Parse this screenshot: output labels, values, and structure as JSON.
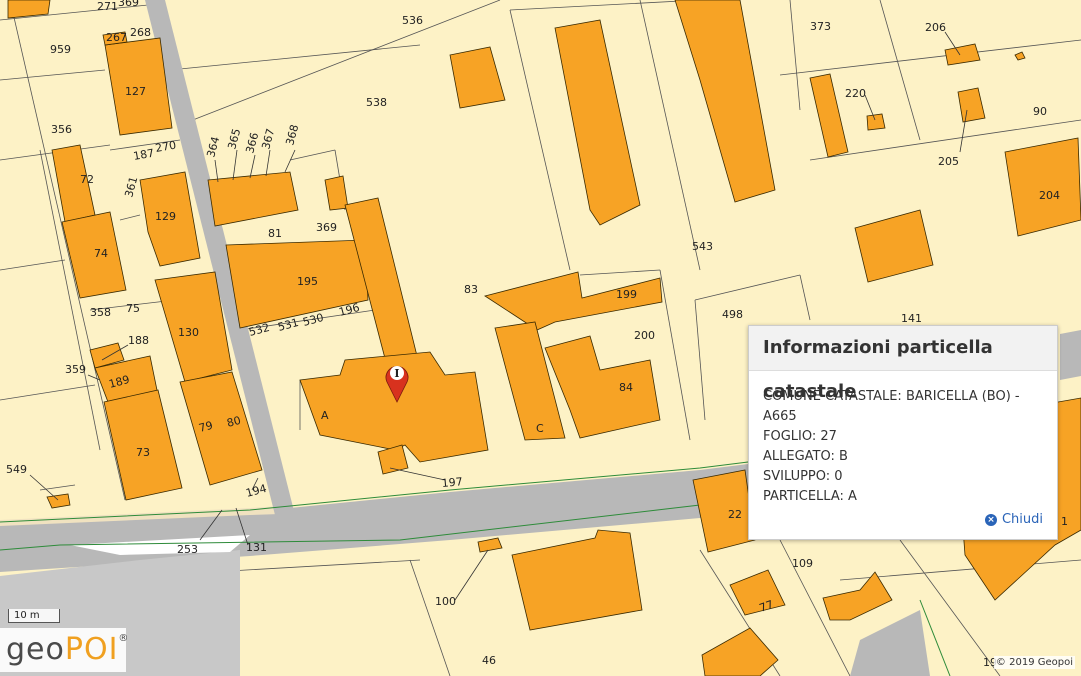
{
  "map": {
    "parcel_labels": [
      {
        "id": "p271",
        "t": "271"
      },
      {
        "id": "p369t",
        "t": "369"
      },
      {
        "id": "p536",
        "t": "536"
      },
      {
        "id": "p373",
        "t": "373"
      },
      {
        "id": "p206",
        "t": "206"
      },
      {
        "id": "p959",
        "t": "959"
      },
      {
        "id": "p267",
        "t": "267"
      },
      {
        "id": "p268",
        "t": "268"
      },
      {
        "id": "p127",
        "t": "127"
      },
      {
        "id": "p538",
        "t": "538"
      },
      {
        "id": "p220",
        "t": "220"
      },
      {
        "id": "p90",
        "t": "90"
      },
      {
        "id": "p356",
        "t": "356"
      },
      {
        "id": "p187",
        "t": "187"
      },
      {
        "id": "p270",
        "t": "270"
      },
      {
        "id": "p364",
        "t": "364"
      },
      {
        "id": "p365",
        "t": "365"
      },
      {
        "id": "p366",
        "t": "366"
      },
      {
        "id": "p367",
        "t": "367"
      },
      {
        "id": "p368",
        "t": "368"
      },
      {
        "id": "p205",
        "t": "205"
      },
      {
        "id": "p72",
        "t": "72"
      },
      {
        "id": "p361",
        "t": "361"
      },
      {
        "id": "p129",
        "t": "129"
      },
      {
        "id": "p204",
        "t": "204"
      },
      {
        "id": "p81",
        "t": "81"
      },
      {
        "id": "p369",
        "t": "369"
      },
      {
        "id": "p74",
        "t": "74"
      },
      {
        "id": "p543",
        "t": "543"
      },
      {
        "id": "p195",
        "t": "195"
      },
      {
        "id": "p83",
        "t": "83"
      },
      {
        "id": "p199",
        "t": "199"
      },
      {
        "id": "p75",
        "t": "75"
      },
      {
        "id": "p358",
        "t": "358"
      },
      {
        "id": "p196",
        "t": "196"
      },
      {
        "id": "p498",
        "t": "498"
      },
      {
        "id": "p141",
        "t": "141"
      },
      {
        "id": "p532",
        "t": "532"
      },
      {
        "id": "p531",
        "t": "531"
      },
      {
        "id": "p530",
        "t": "530"
      },
      {
        "id": "p200",
        "t": "200"
      },
      {
        "id": "p188",
        "t": "188"
      },
      {
        "id": "p130",
        "t": "130"
      },
      {
        "id": "p359",
        "t": "359"
      },
      {
        "id": "p189",
        "t": "189"
      },
      {
        "id": "pA",
        "t": "A"
      },
      {
        "id": "p84",
        "t": "84"
      },
      {
        "id": "p79",
        "t": "79"
      },
      {
        "id": "p80",
        "t": "80"
      },
      {
        "id": "p73",
        "t": "73"
      },
      {
        "id": "pC",
        "t": "C"
      },
      {
        "id": "p549",
        "t": "549"
      },
      {
        "id": "p197",
        "t": "197"
      },
      {
        "id": "p194",
        "t": "194"
      },
      {
        "id": "p22",
        "t": "22"
      },
      {
        "id": "p1",
        "t": "1"
      },
      {
        "id": "p253",
        "t": "253"
      },
      {
        "id": "p131",
        "t": "131"
      },
      {
        "id": "p109",
        "t": "109"
      },
      {
        "id": "p100",
        "t": "100"
      },
      {
        "id": "p77",
        "t": "77"
      },
      {
        "id": "p46",
        "t": "46"
      },
      {
        "id": "p19",
        "t": "19"
      }
    ]
  },
  "marker": {
    "glyph": "I"
  },
  "popup": {
    "title": "Informazioni particella catastale",
    "lines": [
      "COMUNE CATASTALE: BARICELLA (BO) - A665",
      "FOGLIO: 27",
      "ALLEGATO: B",
      "SVILUPPO: 0",
      "PARTICELLA: A"
    ],
    "close_label": "Chiudi"
  },
  "scale": {
    "label": "10 m"
  },
  "logo": {
    "text_a": "geo",
    "text_b": "POI",
    "reg": "®"
  },
  "copyright": "© 2019 Geopoi",
  "colors": {
    "background": "#fdf2c6",
    "building": "#f7a325",
    "road": "#b8b8b8",
    "boundary": "#2e8b3a",
    "marker": "#d8321e",
    "link": "#2a64b8"
  }
}
